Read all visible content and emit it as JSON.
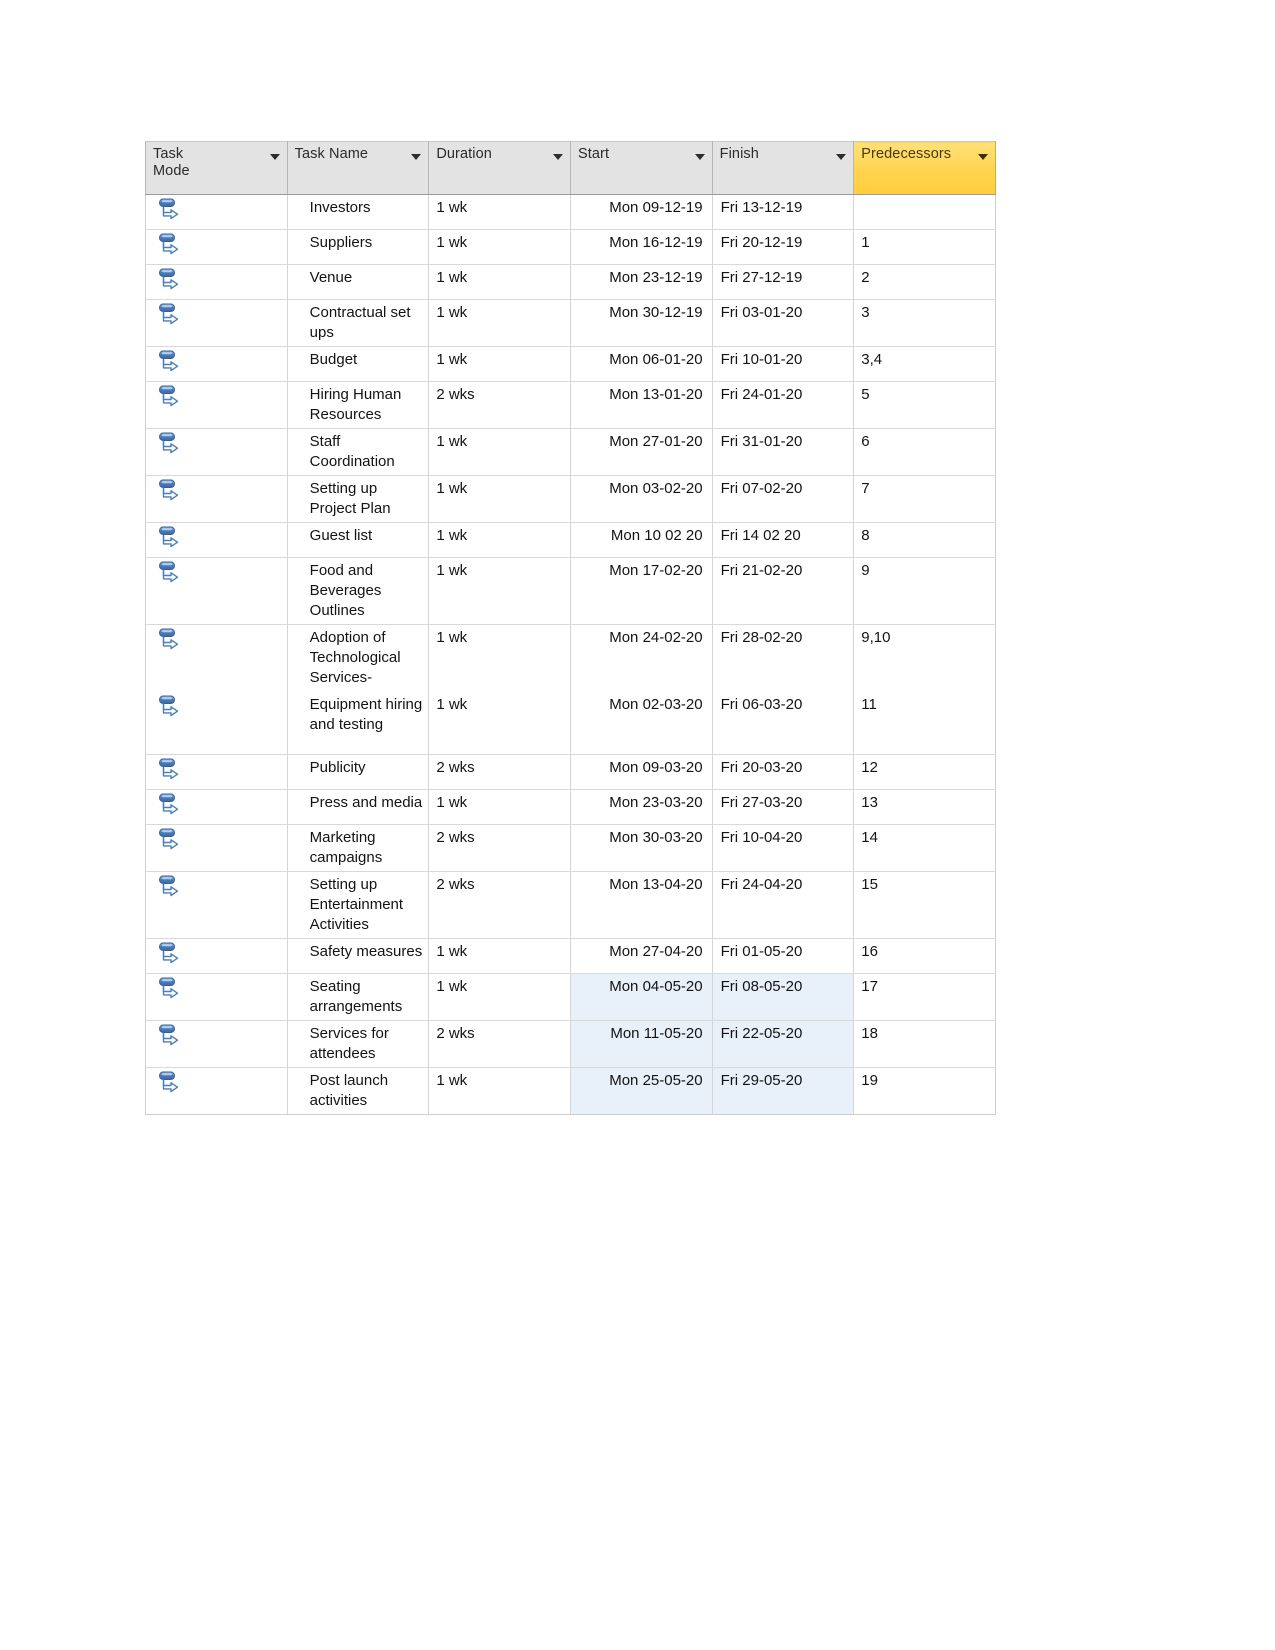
{
  "table": {
    "columns": [
      {
        "key": "mode",
        "label": "Task\nMode",
        "selected": false,
        "has_filter": true
      },
      {
        "key": "name",
        "label": "Task Name",
        "selected": false,
        "has_filter": true
      },
      {
        "key": "dur",
        "label": "Duration",
        "selected": false,
        "has_filter": true
      },
      {
        "key": "start",
        "label": "Start",
        "selected": false,
        "has_filter": true
      },
      {
        "key": "finish",
        "label": "Finish",
        "selected": false,
        "has_filter": true
      },
      {
        "key": "pred",
        "label": "Predecessors",
        "selected": true,
        "has_filter": true
      }
    ],
    "selected_column_color": "#FFD34E",
    "header_background": "#E3E3E3",
    "row_highlight_color": "#E8F0FA",
    "task_mode_icon": "auto-scheduled-icon",
    "rows": [
      {
        "mode": "auto-scheduled-icon",
        "name": "Investors",
        "dur": "1 wk",
        "start": "Mon 09-12-19",
        "finish": "Fri 13-12-19",
        "pred": "",
        "tall": false,
        "sep": true,
        "hl": false
      },
      {
        "mode": "auto-scheduled-icon",
        "name": "Suppliers",
        "dur": "1 wk",
        "start": "Mon 16-12-19",
        "finish": "Fri 20-12-19",
        "pred": "1",
        "tall": false,
        "sep": true,
        "hl": false
      },
      {
        "mode": "auto-scheduled-icon",
        "name": "Venue",
        "dur": "1 wk",
        "start": "Mon 23-12-19",
        "finish": "Fri 27-12-19",
        "pred": "2",
        "tall": false,
        "sep": true,
        "hl": false
      },
      {
        "mode": "auto-scheduled-icon",
        "name": "Contractual set ups",
        "dur": "1 wk",
        "start": "Mon 30-12-19",
        "finish": "Fri 03-01-20",
        "pred": "3",
        "tall": false,
        "sep": true,
        "hl": false
      },
      {
        "mode": "auto-scheduled-icon",
        "name": "Budget",
        "dur": "1 wk",
        "start": "Mon 06-01-20",
        "finish": "Fri 10-01-20",
        "pred": "3,4",
        "tall": false,
        "sep": true,
        "hl": false
      },
      {
        "mode": "auto-scheduled-icon",
        "name": "Hiring Human Resources",
        "dur": "2 wks",
        "start": "Mon 13-01-20",
        "finish": "Fri 24-01-20",
        "pred": "5",
        "tall": false,
        "sep": true,
        "hl": false
      },
      {
        "mode": "auto-scheduled-icon",
        "name": "Staff Coordination",
        "dur": "1 wk",
        "start": "Mon 27-01-20",
        "finish": "Fri 31-01-20",
        "pred": "6",
        "tall": false,
        "sep": true,
        "hl": false
      },
      {
        "mode": "auto-scheduled-icon",
        "name": "Setting up Project Plan",
        "dur": "1 wk",
        "start": "Mon 03-02-20",
        "finish": "Fri 07-02-20",
        "pred": "7",
        "tall": false,
        "sep": true,
        "hl": false
      },
      {
        "mode": "auto-scheduled-icon",
        "name": "Guest list",
        "dur": "1 wk",
        "start": "Mon 10 02 20",
        "finish": "Fri 14 02 20",
        "pred": "8",
        "tall": false,
        "sep": true,
        "hl": false
      },
      {
        "mode": "auto-scheduled-icon",
        "name": "Food and Beverages Outlines",
        "dur": "1 wk",
        "start": "Mon 17-02-20",
        "finish": "Fri 21-02-20",
        "pred": "9",
        "tall": true,
        "sep": true,
        "hl": false
      },
      {
        "mode": "auto-scheduled-icon",
        "name": "Adoption of Technological Services-",
        "dur": "1 wk",
        "start": "Mon 24-02-20",
        "finish": "Fri 28-02-20",
        "pred": "9,10",
        "tall": true,
        "sep": false,
        "hl": false
      },
      {
        "mode": "auto-scheduled-icon",
        "name": "Equipment hiring and testing",
        "dur": "1 wk",
        "start": "Mon 02-03-20",
        "finish": "Fri 06-03-20",
        "pred": "11",
        "tall": true,
        "sep": true,
        "hl": false
      },
      {
        "mode": "auto-scheduled-icon",
        "name": "Publicity",
        "dur": "2 wks",
        "start": "Mon 09-03-20",
        "finish": "Fri 20-03-20",
        "pred": "12",
        "tall": false,
        "sep": true,
        "hl": false
      },
      {
        "mode": "auto-scheduled-icon",
        "name": "Press and media",
        "dur": "1 wk",
        "start": "Mon 23-03-20",
        "finish": "Fri 27-03-20",
        "pred": "13",
        "tall": false,
        "sep": true,
        "hl": false
      },
      {
        "mode": "auto-scheduled-icon",
        "name": "Marketing campaigns",
        "dur": "2 wks",
        "start": "Mon 30-03-20",
        "finish": "Fri 10-04-20",
        "pred": "14",
        "tall": false,
        "sep": true,
        "hl": false
      },
      {
        "mode": "auto-scheduled-icon",
        "name": "Setting up Entertainment Activities",
        "dur": "2 wks",
        "start": "Mon 13-04-20",
        "finish": "Fri 24-04-20",
        "pred": "15",
        "tall": true,
        "sep": true,
        "hl": false
      },
      {
        "mode": "auto-scheduled-icon",
        "name": "Safety measures",
        "dur": "1 wk",
        "start": "Mon 27-04-20",
        "finish": "Fri 01-05-20",
        "pred": "16",
        "tall": false,
        "sep": true,
        "hl": false
      },
      {
        "mode": "auto-scheduled-icon",
        "name": "Seating arrangements",
        "dur": "1 wk",
        "start": "Mon 04-05-20",
        "finish": "Fri 08-05-20",
        "pred": "17",
        "tall": false,
        "sep": true,
        "hl": true
      },
      {
        "mode": "auto-scheduled-icon",
        "name": "Services for attendees",
        "dur": "2 wks",
        "start": "Mon 11-05-20",
        "finish": "Fri 22-05-20",
        "pred": "18",
        "tall": false,
        "sep": true,
        "hl": true
      },
      {
        "mode": "auto-scheduled-icon",
        "name": "Post launch activities",
        "dur": "1 wk",
        "start": "Mon 25-05-20",
        "finish": "Fri 29-05-20",
        "pred": "19",
        "tall": false,
        "sep": true,
        "hl": true
      }
    ]
  }
}
